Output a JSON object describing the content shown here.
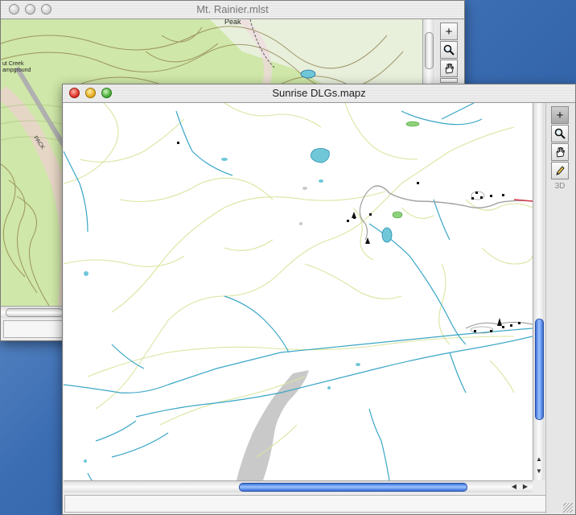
{
  "windows": {
    "back": {
      "title": "Mt. Rainier.mlst"
    },
    "front": {
      "title": "Sunrise DLGs.mapz"
    }
  },
  "topo_labels": {
    "peak": "Peak",
    "creek": "ut Creek",
    "campground": "ampground",
    "pack": "PACK"
  },
  "tools": {
    "add": "+",
    "zoom_icon": "magnifier-icon",
    "pan_icon": "hand-icon",
    "pencil_icon": "pencil-icon",
    "three_d": "3D"
  },
  "colors": {
    "trail": "#d8e6a0",
    "stream": "#3aa6c6",
    "lake": "#6fc7d8",
    "glacier": "#c9c9c9",
    "road": "#a0a0a0",
    "road_red": "#d23a4a",
    "topo_fill": "#cfe7a8",
    "topo_contour": "#8a7a45"
  },
  "scroll": {
    "front_vertical_fraction": 0.8,
    "front_horizontal_fraction": 0.5
  }
}
